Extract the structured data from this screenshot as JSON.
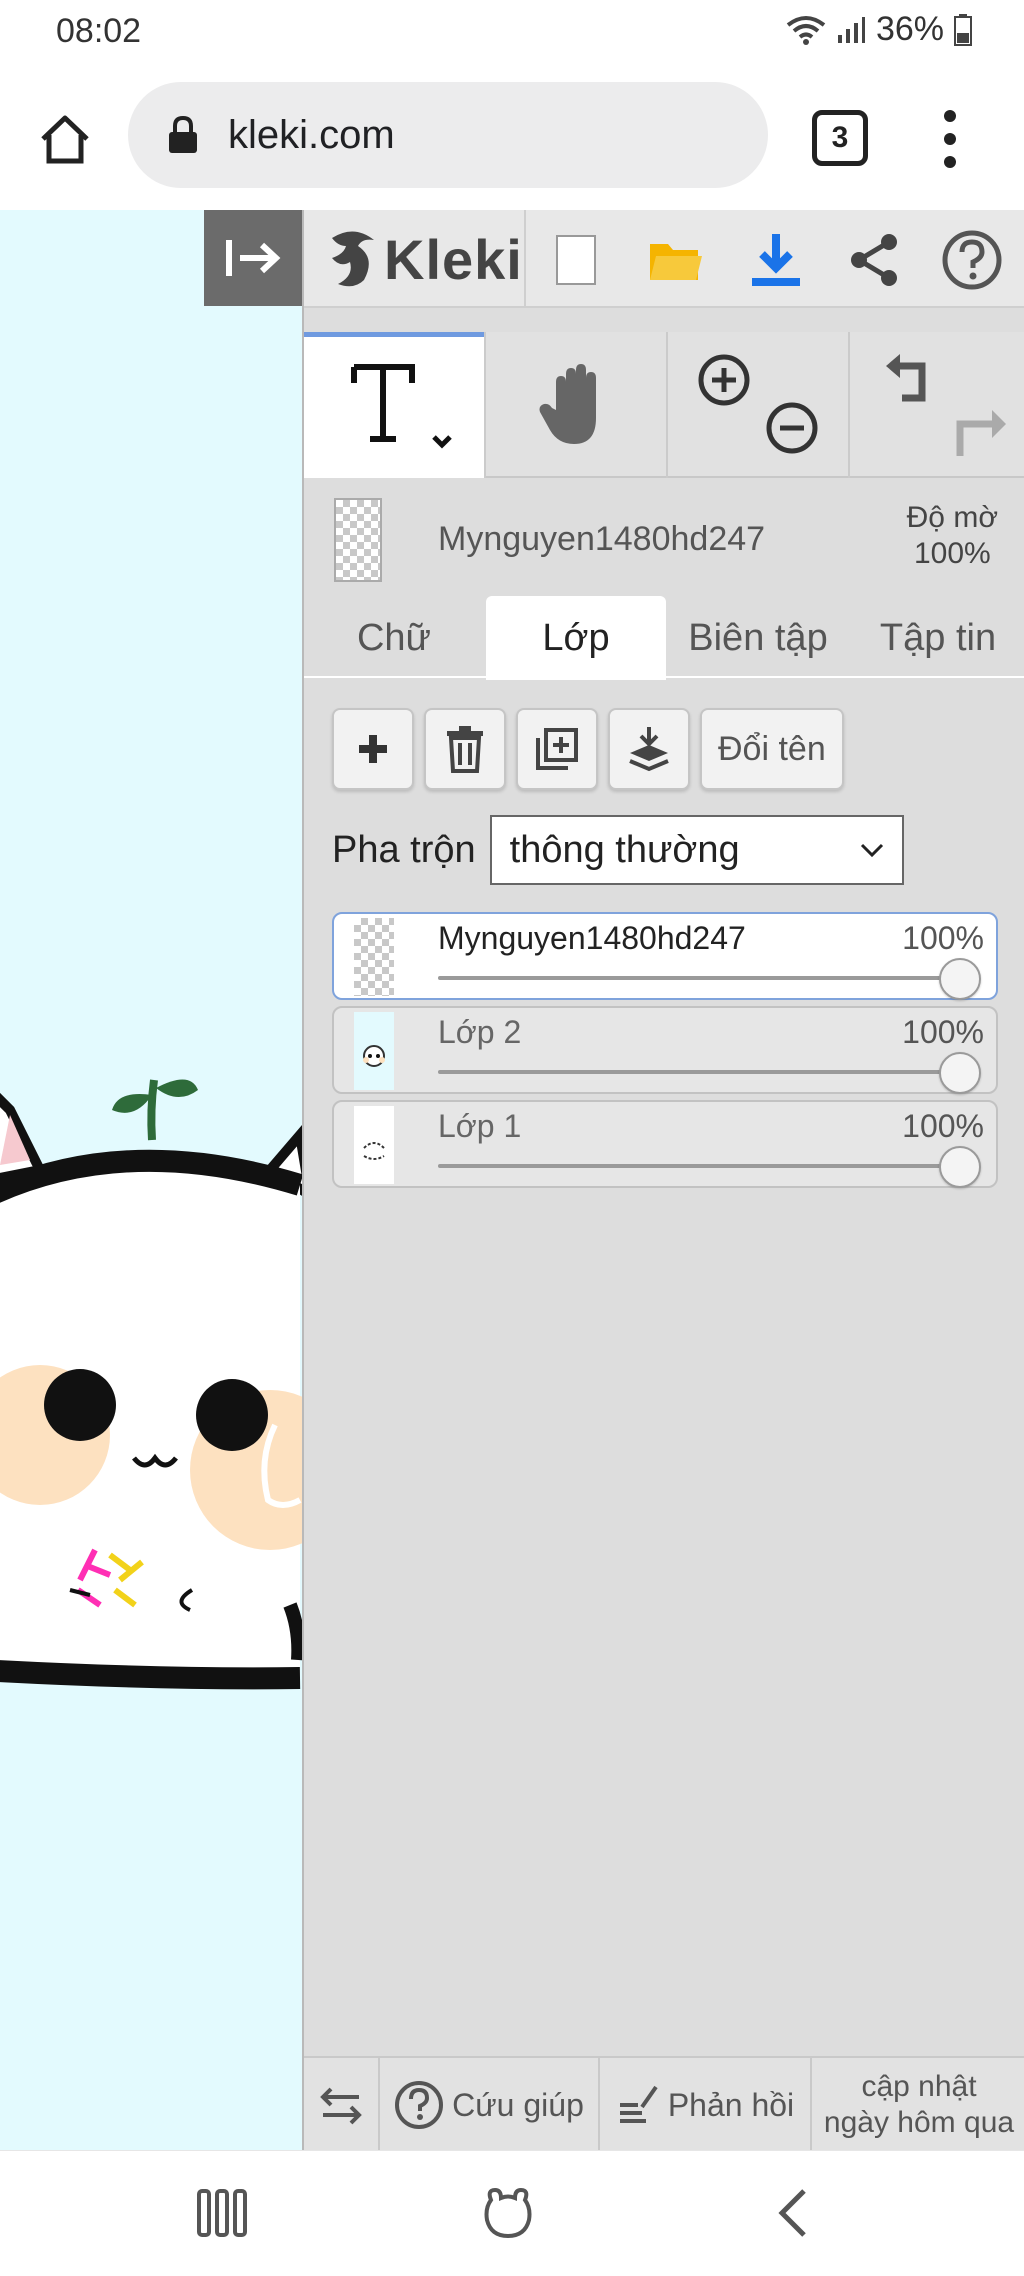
{
  "status_bar": {
    "time": "08:02",
    "battery": "36%"
  },
  "browser": {
    "url": "kleki.com",
    "tab_count": "3"
  },
  "app": {
    "logo_text": "Kleki"
  },
  "current_layer": {
    "name": "Mynguyen1480hd247",
    "opacity_label": "Độ mờ",
    "opacity_value": "100%"
  },
  "tabs": [
    {
      "label": "Chữ"
    },
    {
      "label": "Lớp"
    },
    {
      "label": "Biên tập"
    },
    {
      "label": "Tập tin"
    }
  ],
  "layer_buttons": {
    "rename_label": "Đổi tên"
  },
  "blend": {
    "label": "Pha trộn",
    "selected": "thông thường"
  },
  "layers": [
    {
      "name": "Mynguyen1480hd247",
      "opacity": "100%",
      "opacity_fraction": 1.0
    },
    {
      "name": "Lớp 2",
      "opacity": "100%",
      "opacity_fraction": 1.0
    },
    {
      "name": "Lớp 1",
      "opacity": "100%",
      "opacity_fraction": 1.0
    }
  ],
  "bottom_bar": {
    "help_label": "Cứu giúp",
    "feedback_label": "Phản hồi",
    "update_line1": "cập nhật",
    "update_line2": "ngày hôm qua"
  },
  "colors": {
    "canvas_bg": "#e3fafe",
    "panel_bg": "#dddddd",
    "accent_blue": "#1a73e8",
    "folder_yellow": "#f5b400",
    "sprout_green": "#2e6b3a",
    "cheek_peach": "#fde1c0"
  }
}
